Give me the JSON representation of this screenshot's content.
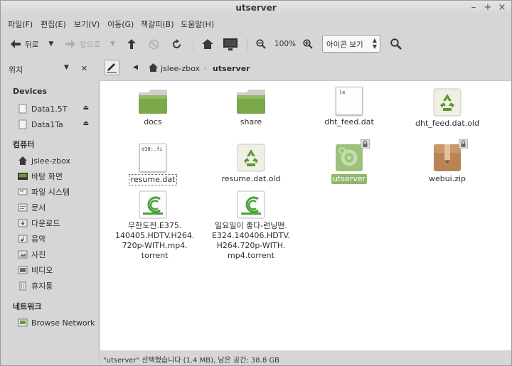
{
  "window": {
    "title": "utserver"
  },
  "menu": [
    "파일(F)",
    "편집(E)",
    "보기(V)",
    "이동(G)",
    "책갈피(B)",
    "도움말(H)"
  ],
  "toolbar": {
    "back_label": "뒤로",
    "forward_label": "앞으로",
    "zoom_level": "100%",
    "view_mode": "아이콘 보기"
  },
  "location": {
    "sidebar_label": "위치",
    "breadcrumb": [
      "jslee-zbox",
      "utserver"
    ]
  },
  "sidebar": {
    "devices_heading": "Devices",
    "devices": [
      "Data1.5T",
      "Data1Ta"
    ],
    "computer_heading": "컴퓨터",
    "computer_items": [
      "jslee-zbox",
      "바탕 화면",
      "파일 시스템",
      "문서",
      "다운로드",
      "음악",
      "사진",
      "비디오",
      "휴지통"
    ],
    "network_heading": "네트워크",
    "network_items": [
      "Browse Network"
    ]
  },
  "files": [
    {
      "name": "docs",
      "type": "folder"
    },
    {
      "name": "share",
      "type": "folder"
    },
    {
      "name": "dht_feed.dat",
      "type": "text",
      "preview": "le"
    },
    {
      "name": "dht_feed.dat.old",
      "type": "recycle"
    },
    {
      "name": "resume.dat",
      "type": "text",
      "preview": "d10:.fi"
    },
    {
      "name": "resume.dat.old",
      "type": "recycle"
    },
    {
      "name": "utserver",
      "type": "exec",
      "selected": true
    },
    {
      "name": "webui.zip",
      "type": "zip"
    },
    {
      "name": "무한도전.E375.\n140405.HDTV.H264.\n720p-WITH.mp4.\ntorrent",
      "type": "torrent"
    },
    {
      "name": "일요일이 좋다-런닝맨.\nE324.140406.HDTV.\nH264.720p-WITH.\nmp4.torrent",
      "type": "torrent"
    }
  ],
  "status": "\"utserver\" 선택했습니다 (1.4 MB), 남은 공간: 38.8 GB",
  "colors": {
    "selection": "#8fb86a",
    "folder": "#7aa84a",
    "recycle": "#5c9a2e"
  }
}
